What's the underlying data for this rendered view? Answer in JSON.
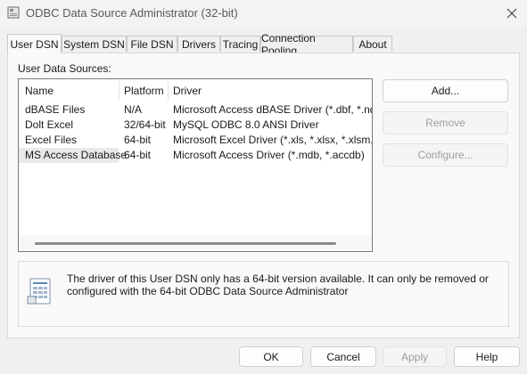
{
  "window": {
    "title": "ODBC Data Source Administrator (32-bit)"
  },
  "tabs": [
    {
      "label": "User DSN",
      "active": true
    },
    {
      "label": "System DSN"
    },
    {
      "label": "File DSN"
    },
    {
      "label": "Drivers"
    },
    {
      "label": "Tracing"
    },
    {
      "label": "Connection Pooling"
    },
    {
      "label": "About"
    }
  ],
  "main": {
    "section_label": "User Data Sources:",
    "columns": [
      "Name",
      "Platform",
      "Driver"
    ],
    "rows": [
      {
        "name": "dBASE Files",
        "platform": "N/A",
        "driver": "Microsoft Access dBASE Driver (*.dbf, *.ndx, *.r"
      },
      {
        "name": "Dolt Excel",
        "platform": "32/64-bit",
        "driver": "MySQL ODBC 8.0 ANSI Driver"
      },
      {
        "name": "Excel Files",
        "platform": "64-bit",
        "driver": "Microsoft Excel Driver (*.xls, *.xlsx, *.xlsm, *.xlsb"
      },
      {
        "name": "MS Access Database",
        "platform": "64-bit",
        "driver": "Microsoft Access Driver (*.mdb, *.accdb)",
        "selected": true
      }
    ],
    "buttons": {
      "add": "Add...",
      "remove": "Remove",
      "configure": "Configure..."
    }
  },
  "info": {
    "text": "The driver of this User DSN only has a 64-bit version available. It can only be removed or configured with the 64-bit ODBC Data Source Administrator"
  },
  "footer": {
    "ok": "OK",
    "cancel": "Cancel",
    "apply": "Apply",
    "help": "Help"
  },
  "icons": {
    "app": "odbc-app-icon",
    "close": "close-icon",
    "info": "data-source-info-icon"
  },
  "colors": {
    "selected_row": "#e9e9e9",
    "disabled_text": "#9d9d9d"
  }
}
